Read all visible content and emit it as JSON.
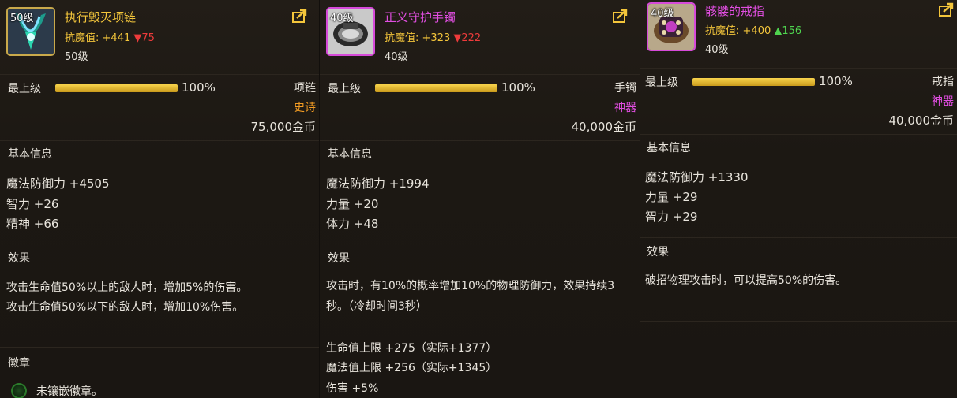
{
  "items": [
    {
      "level_tag": "50级",
      "name": "执行毁灭项链",
      "stat_label": "抗魔值:",
      "stat_value": "+441",
      "stat_delta_symbol": "▼",
      "stat_delta": "75",
      "level_note": "50级",
      "tier_label": "最上级",
      "progress": 1.0,
      "progress_text": "100%",
      "slot": "项链",
      "grade": "史诗",
      "price": "75,000金币",
      "basic_info_title": "基本信息",
      "basic_info": [
        "魔法防御力 +4505",
        "智力 +26",
        "精神 +66"
      ],
      "effect_title": "效果",
      "effects": [
        "攻击生命值50%以上的敌人时，增加5%的伤害。",
        "攻击生命值50%以下的敌人时，增加10%伤害。"
      ],
      "emblem_title": "徽章",
      "emblem_text": "未镶嵌徽章。"
    },
    {
      "level_tag": "40级",
      "name": "正义守护手镯",
      "stat_label": "抗魔值:",
      "stat_value": "+323",
      "stat_delta_symbol": "▼",
      "stat_delta": "222",
      "level_note": "40级",
      "tier_label": "最上级",
      "progress": 1.0,
      "progress_text": "100%",
      "slot": "手镯",
      "grade": "神器",
      "price": "40,000金币",
      "basic_info_title": "基本信息",
      "basic_info": [
        "魔法防御力 +1994",
        "力量 +20",
        "体力 +48"
      ],
      "effect_title": "效果",
      "effects": [
        "攻击时，有10%的概率增加10%的物理防御力，效果持续3秒。（冷却时间3秒）"
      ],
      "extra_stats": [
        "生命值上限 +275（实际+1377）",
        "魔法值上限 +256（实际+1345）",
        "伤害 +5%"
      ]
    },
    {
      "level_tag": "40级",
      "name": "骸髅的戒指",
      "stat_label": "抗魔值:",
      "stat_value": "+400",
      "stat_delta_symbol": "▲",
      "stat_delta": "156",
      "level_note": "40级",
      "tier_label": "最上级",
      "progress": 1.0,
      "progress_text": "100%",
      "slot": "戒指",
      "grade": "神器",
      "price": "40,000金币",
      "basic_info_title": "基本信息",
      "basic_info": [
        "魔法防御力 +1330",
        "力量 +29",
        "智力 +29"
      ],
      "effect_title": "效果",
      "effects": [
        "破招物理攻击时，可以提高50%的伤害。"
      ]
    }
  ],
  "colors": {
    "epic_gold": "#f3c53b",
    "epic_grade": "#f39c23",
    "artifact": "#e04ee0",
    "down": "#ee3b3b",
    "up": "#4fd44f"
  },
  "icons": [
    "share-icon",
    "necklace-icon",
    "bracelet-icon",
    "ring-icon",
    "emblem-slot-icon"
  ]
}
